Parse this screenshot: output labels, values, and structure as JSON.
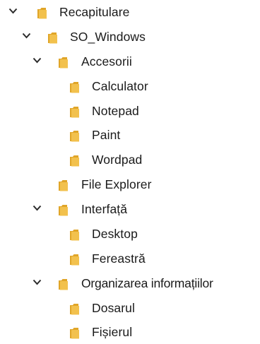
{
  "tree": {
    "nodes": [
      {
        "label": "Recapitulare",
        "expanded": true,
        "icon": "folder-icon"
      },
      {
        "label": "SO_Windows",
        "expanded": true,
        "icon": "folder-icon"
      },
      {
        "label": "Accesorii",
        "expanded": true,
        "icon": "folder-icon"
      },
      {
        "label": "Calculator",
        "expanded": false,
        "icon": "folder-icon"
      },
      {
        "label": "Notepad",
        "expanded": false,
        "icon": "folder-icon"
      },
      {
        "label": "Paint",
        "expanded": false,
        "icon": "folder-icon"
      },
      {
        "label": "Wordpad",
        "expanded": false,
        "icon": "folder-icon"
      },
      {
        "label": "File Explorer",
        "expanded": false,
        "icon": "folder-icon"
      },
      {
        "label": "Interfață",
        "expanded": true,
        "icon": "folder-icon"
      },
      {
        "label": "Desktop",
        "expanded": false,
        "icon": "folder-icon"
      },
      {
        "label": "Fereastră",
        "expanded": false,
        "icon": "folder-icon"
      },
      {
        "label": "Organizarea informațiilor",
        "expanded": true,
        "icon": "folder-icon"
      },
      {
        "label": "Dosarul",
        "expanded": false,
        "icon": "folder-icon"
      },
      {
        "label": "Fișierul",
        "expanded": false,
        "icon": "folder-icon"
      }
    ]
  },
  "colors": {
    "folder": "#f2c14d",
    "folder_back": "#e0a528",
    "chevron": "#2b2b2b",
    "text": "#1a1a1a"
  }
}
